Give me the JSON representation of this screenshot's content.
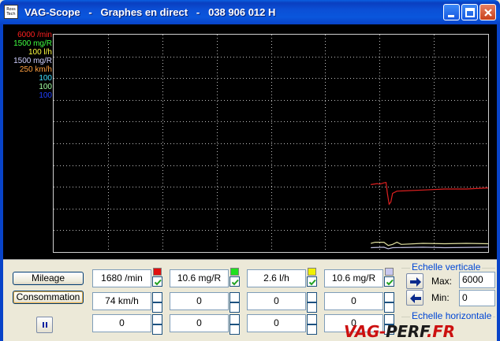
{
  "window": {
    "title": "VAG-Scope   -   Graphes en direct   -   038 906 012 H",
    "icon_text": "Ross Tech"
  },
  "legend": [
    {
      "label": "6000 /min",
      "color": "#ff2020"
    },
    {
      "label": "1500 mg/R",
      "color": "#40ff40"
    },
    {
      "label": "100 l/h",
      "color": "#ffff40"
    },
    {
      "label": "1500 mg/R",
      "color": "#d0d0ff"
    },
    {
      "label": "250 km/h",
      "color": "#ffa040"
    },
    {
      "label": "100",
      "color": "#40e0ff"
    },
    {
      "label": "100",
      "color": "#a0ffa0"
    },
    {
      "label": "100",
      "color": "#2040ff"
    }
  ],
  "chart_data": {
    "type": "line",
    "grid": true,
    "series": [
      {
        "name": "6000 /min",
        "color": "#e02020",
        "points": [
          [
            0.73,
            0.31
          ],
          [
            0.745,
            0.315
          ],
          [
            0.75,
            0.312
          ],
          [
            0.76,
            0.318
          ],
          [
            0.765,
            0.32
          ],
          [
            0.768,
            0.27
          ],
          [
            0.772,
            0.22
          ],
          [
            0.776,
            0.23
          ],
          [
            0.78,
            0.27
          ],
          [
            0.79,
            0.28
          ],
          [
            0.85,
            0.285
          ],
          [
            0.9,
            0.29
          ],
          [
            0.95,
            0.29
          ],
          [
            1.0,
            0.295
          ]
        ]
      },
      {
        "name": "1500 mg/R",
        "color": "#e0e0a0",
        "points": [
          [
            0.73,
            0.04
          ],
          [
            0.74,
            0.045
          ],
          [
            0.76,
            0.045
          ],
          [
            0.77,
            0.03
          ],
          [
            0.78,
            0.035
          ],
          [
            0.79,
            0.045
          ],
          [
            0.8,
            0.035
          ],
          [
            0.85,
            0.04
          ],
          [
            0.9,
            0.038
          ],
          [
            0.95,
            0.04
          ],
          [
            1.0,
            0.038
          ]
        ]
      },
      {
        "name": "1500 mg/R",
        "color": "#c0c0e0",
        "points": [
          [
            0.73,
            0.02
          ],
          [
            0.76,
            0.022
          ],
          [
            0.77,
            0.015
          ],
          [
            0.78,
            0.02
          ],
          [
            0.85,
            0.022
          ],
          [
            0.9,
            0.02
          ],
          [
            1.0,
            0.022
          ]
        ]
      }
    ]
  },
  "buttons": {
    "mileage": "Mileage",
    "consumption": "Consommation"
  },
  "channels": {
    "row1": [
      "1680 /min",
      "10.6 mg/R",
      "2.6 l/h",
      "10.6 mg/R"
    ],
    "row2": [
      "74 km/h",
      "0",
      "0",
      "0"
    ],
    "row3": [
      "0",
      "0",
      "0",
      "0"
    ],
    "swatches": [
      "#e01010",
      "#20e020",
      "#f0f000",
      "#c8c8f0"
    ]
  },
  "vertical_scale": {
    "title": "Echelle verticale",
    "max_label": "Max:",
    "min_label": "Min:",
    "max_value": "6000",
    "min_value": "0"
  },
  "horizontal_scale": {
    "title": "Echelle horizontale"
  },
  "watermark": {
    "part1": "VAG-",
    "part2": "PERF",
    "part3": ".FR"
  }
}
